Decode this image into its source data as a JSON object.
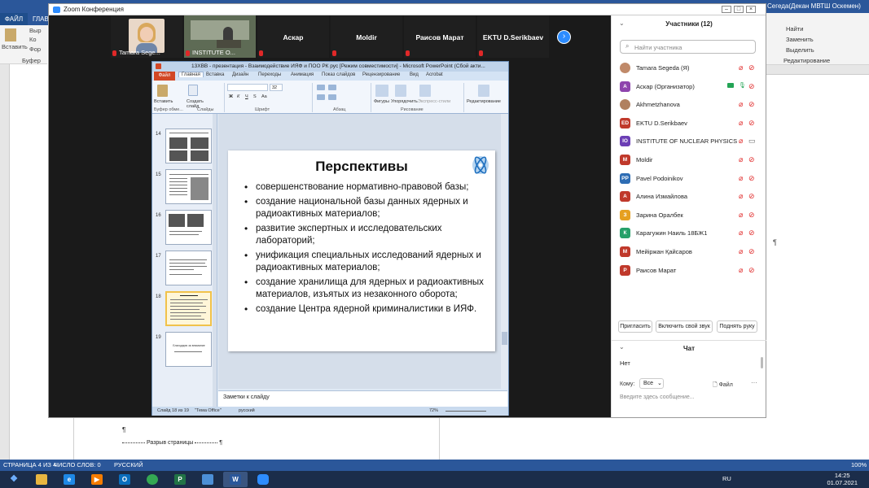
{
  "word": {
    "file_tab": "ФАЙЛ",
    "home_tab": "ГЛАВ",
    "title_right": "Сегеда(Декан МВТШ Оскемен)",
    "left_ribbon": {
      "paste": "Вставить",
      "cut": "Выр",
      "copy": "Ко",
      "format": "Фор",
      "clipboard": "Буфер обм"
    },
    "right_ribbon": {
      "find": "Найти",
      "replace": "Заменить",
      "select": "Выделить",
      "editing": "Редактирование"
    },
    "pilcrow": "¶",
    "para_mark": "¶",
    "page_break": "Разрыв страницы",
    "status": {
      "page": "СТРАНИЦА 4 ИЗ 4",
      "words": "ЧИСЛО СЛОВ: 0",
      "lang": "РУССКИЙ",
      "zoom": "100%"
    }
  },
  "taskbar": {
    "lang": "RU",
    "time": "14:25",
    "date": "01.07.2021",
    "apps": [
      {
        "name": "explorer",
        "glyph": "",
        "color": "#e8b640"
      },
      {
        "name": "ie",
        "glyph": "e",
        "color": "#1e88e5"
      },
      {
        "name": "media",
        "glyph": "▶",
        "color": "#f57c00"
      },
      {
        "name": "outlook",
        "glyph": "O",
        "color": "#0a6ebd"
      },
      {
        "name": "chrome",
        "glyph": "",
        "color": "#34a853"
      },
      {
        "name": "project",
        "glyph": "P",
        "color": "#217346"
      },
      {
        "name": "screen",
        "glyph": "",
        "color": "#4c8fd6"
      },
      {
        "name": "word",
        "glyph": "W",
        "color": "#2b579a"
      },
      {
        "name": "zoom",
        "glyph": "",
        "color": "#2d8cff"
      }
    ]
  },
  "zoom": {
    "window_title": "Zoom Конференция",
    "thumbs": [
      {
        "name": "",
        "label": "Tamara Sege...",
        "type": "photo"
      },
      {
        "name": "",
        "label": "INSTITUTE O...",
        "type": "video"
      },
      {
        "name": "Аскар",
        "label": ""
      },
      {
        "name": "Moldir",
        "label": ""
      },
      {
        "name": "Раисов Марат",
        "label": ""
      },
      {
        "name": "EKTU D.Serikbaev",
        "label": ""
      }
    ],
    "next_arrow": "›"
  },
  "ppt": {
    "title": "13ХВВ - презентация - Взаимодействие ИЯФ и ПОО РК рус [Режим совместимости] - Microsoft PowerPoint (Сбой акти...",
    "tabs": [
      "Файл",
      "Главная",
      "Вставка",
      "Дизайн",
      "Переходы",
      "Анимация",
      "Показ слайдов",
      "Рецензирование",
      "Вид",
      "Acrobat"
    ],
    "ribbon": {
      "paste": "Вставить",
      "create_slide": "Создать слайд",
      "clipboard": "Буфер обме...",
      "slides": "Слайды",
      "font_size": "32",
      "font": "Шрифт",
      "paragraph": "Абзац",
      "shapes": "Фигуры",
      "arrange": "Упорядочить",
      "quick_styles": "Экспресс-стили",
      "drawing": "Рисование",
      "editing": "Редактирование"
    },
    "slide_numbers": [
      "14",
      "15",
      "16",
      "17",
      "18",
      "19"
    ],
    "slide19_text": "Благодарю за внимание",
    "slide": {
      "title": "Перспективы",
      "bullets": [
        "совершенствование нормативно-правовой базы;",
        "создание национальной базы данных ядерных и радиоактивных материалов;",
        "развитие экспертных и исследовательских лабораторий;",
        "унификация специальных исследований ядерных и радиоактивных материалов;",
        "создание хранилища для ядерных и радиоактивных материалов, изъятых из незаконного оборота;",
        "создание Центра ядерной криминалистики в ИЯФ."
      ]
    },
    "notes_placeholder": "Заметки к слайду",
    "status": {
      "slide": "Слайд 18 из 19",
      "theme": "\"Тема Office\"",
      "lang": "русский",
      "zoom": "72%"
    }
  },
  "participants": {
    "header": "Участники (12)",
    "search_placeholder": "Найти участника",
    "list": [
      {
        "name": "Tamara Segeda (Я)",
        "initials": "",
        "color": "#c08a6a",
        "share": false,
        "cam": "off"
      },
      {
        "name": "Аскар (Организатор)",
        "initials": "А",
        "color": "#8e44ad",
        "share": true,
        "cam": "off"
      },
      {
        "name": "Akhmetzhanova",
        "initials": "",
        "color": "#b08060",
        "share": false,
        "cam": "off"
      },
      {
        "name": "EKTU D.Serikbaev",
        "initials": "ED",
        "color": "#c0392b",
        "share": false,
        "cam": "off"
      },
      {
        "name": "INSTITUTE OF NUCLEAR PHYSICS",
        "initials": "IO",
        "color": "#6c3fb5",
        "share": false,
        "cam": "on"
      },
      {
        "name": "Moldir",
        "initials": "M",
        "color": "#c0392b",
        "share": false,
        "cam": "off"
      },
      {
        "name": "Pavel Podoinikov",
        "initials": "PP",
        "color": "#2e6db4",
        "share": false,
        "cam": "off"
      },
      {
        "name": "Алина Измайлова",
        "initials": "А",
        "color": "#c0392b",
        "share": false,
        "cam": "off"
      },
      {
        "name": "Зарина Оралбек",
        "initials": "З",
        "color": "#e6a020",
        "share": false,
        "cam": "off"
      },
      {
        "name": "Карагужин Наиль 18БЖ1",
        "initials": "К",
        "color": "#27a06a",
        "share": false,
        "cam": "off"
      },
      {
        "name": "Мейіржан Қайсаров",
        "initials": "М",
        "color": "#c0392b",
        "share": false,
        "cam": "off"
      },
      {
        "name": "Раисов Марат",
        "initials": "Р",
        "color": "#c0392b",
        "share": false,
        "cam": "off"
      }
    ],
    "buttons": [
      "Пригласить",
      "Включить свой звук",
      "Поднять руку"
    ]
  },
  "chat": {
    "header": "Чат",
    "empty": "Нет",
    "to_label": "Кому:",
    "to_value": "Все",
    "file": "Файл",
    "more": "···",
    "input_placeholder": "Введите здесь сообщение..."
  }
}
